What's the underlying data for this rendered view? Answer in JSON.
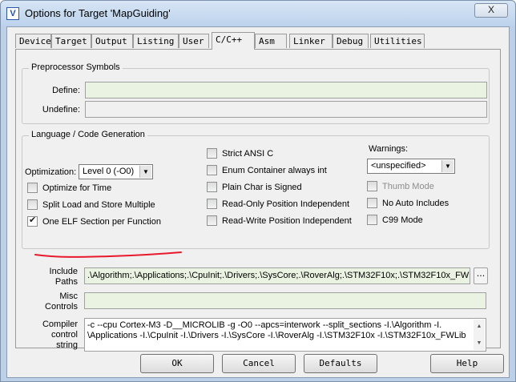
{
  "window": {
    "title": "Options for Target 'MapGuiding'",
    "app_icon": "V",
    "close_glyph": "X"
  },
  "tabs": [
    {
      "label": "Device"
    },
    {
      "label": "Target"
    },
    {
      "label": "Output"
    },
    {
      "label": "Listing"
    },
    {
      "label": "User"
    },
    {
      "label": "C/C++"
    },
    {
      "label": "Asm"
    },
    {
      "label": "Linker"
    },
    {
      "label": "Debug"
    },
    {
      "label": "Utilities"
    }
  ],
  "active_tab": "C/C++",
  "preprocessor": {
    "title": "Preprocessor Symbols",
    "define_label": "Define:",
    "define_value": "",
    "undefine_label": "Undefine:",
    "undefine_value": ""
  },
  "language": {
    "title": "Language / Code Generation",
    "optimization_label": "Optimization:",
    "optimization_value": "Level 0 (-O0)",
    "optimize_for_time": {
      "label": "Optimize for Time",
      "checked": false
    },
    "split_load_store": {
      "label": "Split Load and Store Multiple",
      "checked": false
    },
    "one_elf_section": {
      "label": "One ELF Section per Function",
      "checked": true
    },
    "strict_ansi": {
      "label": "Strict ANSI C",
      "checked": false
    },
    "enum_container": {
      "label": "Enum Container always int",
      "checked": false
    },
    "plain_char_signed": {
      "label": "Plain Char is Signed",
      "checked": false
    },
    "ropi": {
      "label": "Read-Only Position Independent",
      "checked": false
    },
    "rwpi": {
      "label": "Read-Write Position Independent",
      "checked": false
    },
    "warnings_label": "Warnings:",
    "warnings_value": "<unspecified>",
    "thumb_mode": {
      "label": "Thumb Mode",
      "checked": false,
      "disabled": true
    },
    "no_auto_includes": {
      "label": "No Auto Includes",
      "checked": false
    },
    "c99_mode": {
      "label": "C99 Mode",
      "checked": false
    }
  },
  "include_paths": {
    "label_line1": "Include",
    "label_line2": "Paths",
    "value": ".\\Algorithm;.\\Applications;.\\CpuInit;.\\Drivers;.\\SysCore;.\\RoverAlg;.\\STM32F10x;.\\STM32F10x_FWL",
    "browse_label": "..."
  },
  "misc_controls": {
    "label_line1": "Misc",
    "label_line2": "Controls",
    "value": ""
  },
  "compiler_control": {
    "label_line1": "Compiler",
    "label_line2": "control",
    "label_line3": "string",
    "line1": "-c --cpu Cortex-M3 -D__MICROLIB -g -O0 --apcs=interwork --split_sections -I.\\Algorithm -I.",
    "line2": "\\Applications -I.\\CpuInit -I.\\Drivers -I.\\SysCore -I.\\RoverAlg -I.\\STM32F10x -I.\\STM32F10x_FWLib"
  },
  "buttons": {
    "ok": "OK",
    "cancel": "Cancel",
    "defaults": "Defaults",
    "help": "Help"
  },
  "colors": {
    "field_bg": "#eaf2e2",
    "annotation": "#e8192c",
    "title_bar": "#bcd2ec"
  }
}
